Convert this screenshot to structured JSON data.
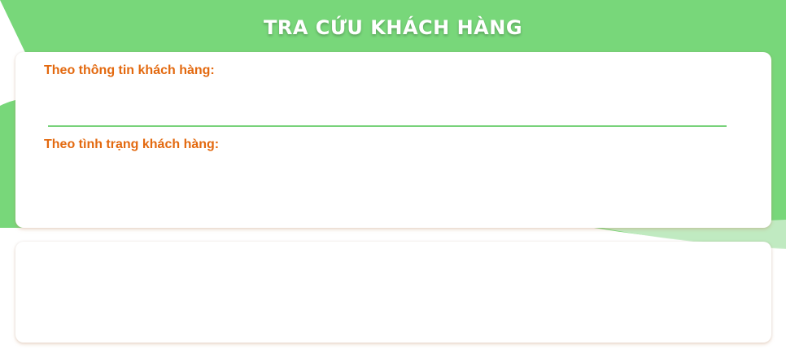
{
  "header": {
    "title": "TRA CỨU KHÁCH HÀNG"
  },
  "search_panel": {
    "customer_info_label": "Theo thông tin khách hàng:",
    "customer_info_value": "",
    "customer_status_label": "Theo tình trạng khách hàng:"
  },
  "colors": {
    "header_green": "#78d77a",
    "accent_orange": "#e3690f",
    "input_underline": "#78d27a"
  }
}
